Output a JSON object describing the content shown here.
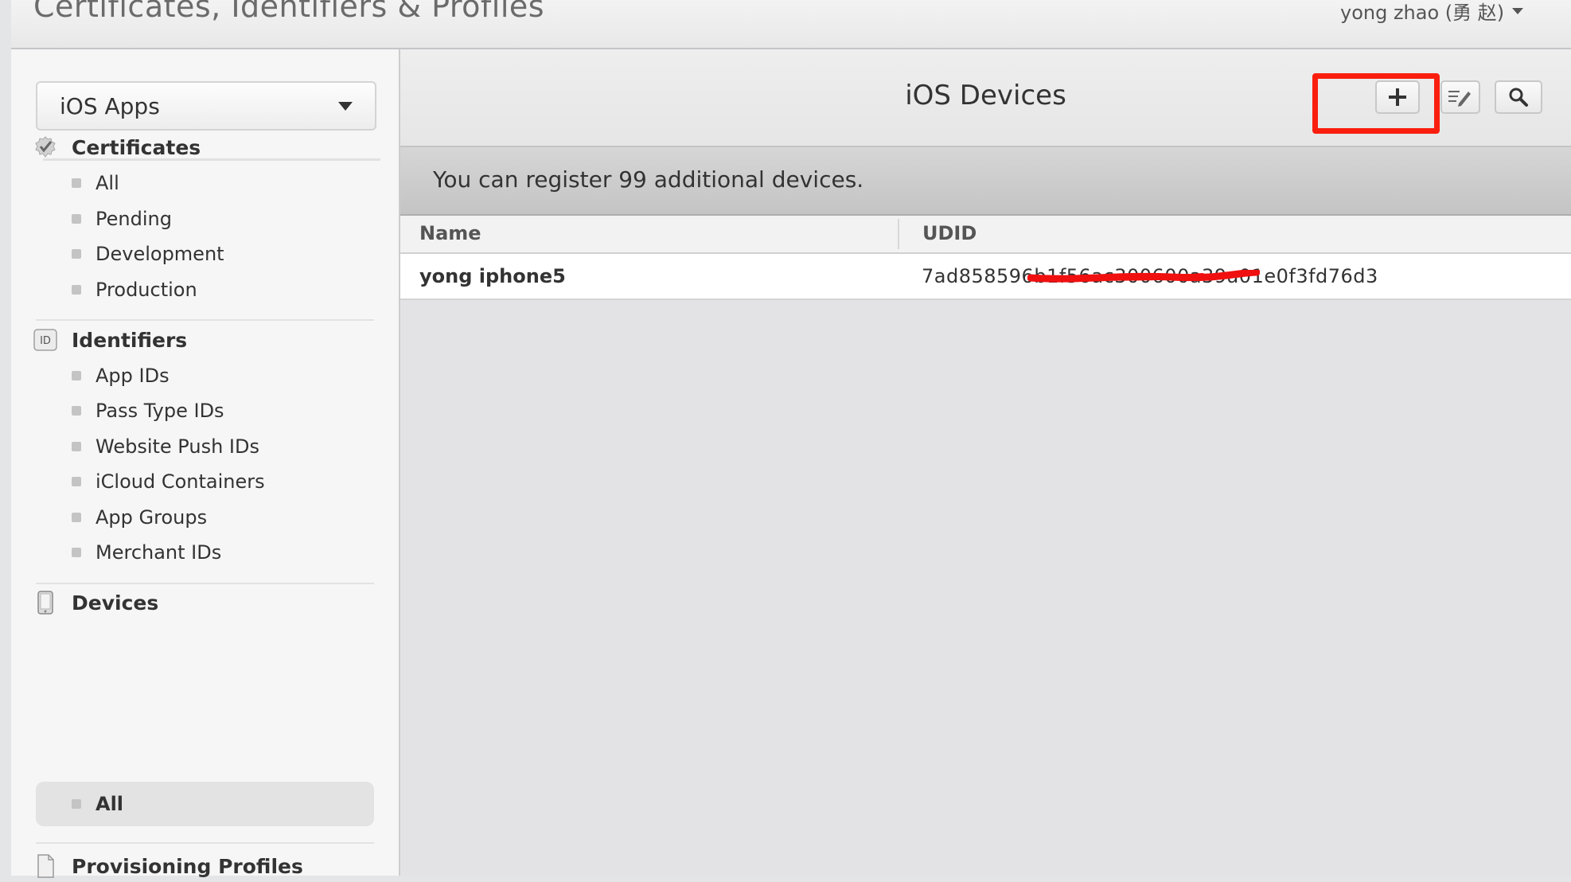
{
  "header": {
    "title": "Certificates, Identifiers & Profiles",
    "user": "yong zhao (勇 赵)"
  },
  "sidebar": {
    "platform": "iOS Apps",
    "sections": [
      {
        "label": "Certificates",
        "icon": "certificate-seal-icon",
        "items": [
          "All",
          "Pending",
          "Development",
          "Production"
        ]
      },
      {
        "label": "Identifiers",
        "icon": "id-badge-icon",
        "items": [
          "App IDs",
          "Pass Type IDs",
          "Website Push IDs",
          "iCloud Containers",
          "App Groups",
          "Merchant IDs"
        ]
      },
      {
        "label": "Devices",
        "icon": "device-icon",
        "items": [
          "All"
        ],
        "active_item": "All"
      },
      {
        "label": "Provisioning Profiles",
        "icon": "document-icon",
        "items": []
      }
    ],
    "id_badge_text": "ID"
  },
  "main": {
    "title": "iOS Devices",
    "toolbar": {
      "add_icon": "plus-icon",
      "edit_icon": "edit-list-icon",
      "search_icon": "magnifier-icon",
      "highlight_color": "#fa1e0e"
    },
    "notice": "You can register 99 additional devices.",
    "table": {
      "columns": [
        "Name",
        "UDID"
      ],
      "rows": [
        {
          "name": "yong iphone5",
          "udid": "7ad858596b1f56ac300600a39a01e0f3fd76d3"
        }
      ]
    }
  },
  "colors": {
    "redaction": "#f01010",
    "accent_highlight": "#fa1e0e"
  }
}
